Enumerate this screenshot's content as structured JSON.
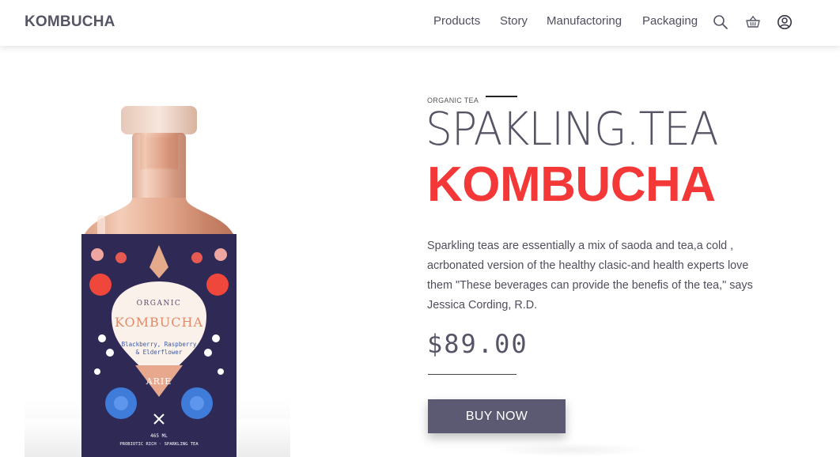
{
  "header": {
    "logo": "KOMBUCHA",
    "nav": [
      {
        "label": "Products"
      },
      {
        "label": "Story"
      },
      {
        "label": "Manufactoring"
      },
      {
        "label": "Packaging"
      }
    ],
    "icons": [
      "search-icon",
      "basket-icon",
      "user-icon"
    ]
  },
  "product": {
    "eyebrow": "ORGANIC TEA",
    "title_line1": "SPAKLING.TEA",
    "title_line2": "KOMBUCHA",
    "description": "Sparkling teas are essentially a mix of saoda and tea,a cold , acrbonated version of the healthy clasic-and health experts love them \"These beverages can provide the benefis of the tea,\" says Jessica Cording, R.D.",
    "price": "$89.00",
    "buy_label": "BUY NOW",
    "label": {
      "organic": "ORGANIC",
      "brand": "KOMBUCHA",
      "flavor_line1": "Blackberry, Raspberry",
      "flavor_line2": "& Elderflower",
      "maker": "ARIE",
      "volume": "465 ML",
      "footer": "PROBIOTIC RICH · SPARKLING TEA"
    }
  },
  "colors": {
    "accent": "#f43838",
    "button": "#5b5a72",
    "text": "#555566"
  }
}
